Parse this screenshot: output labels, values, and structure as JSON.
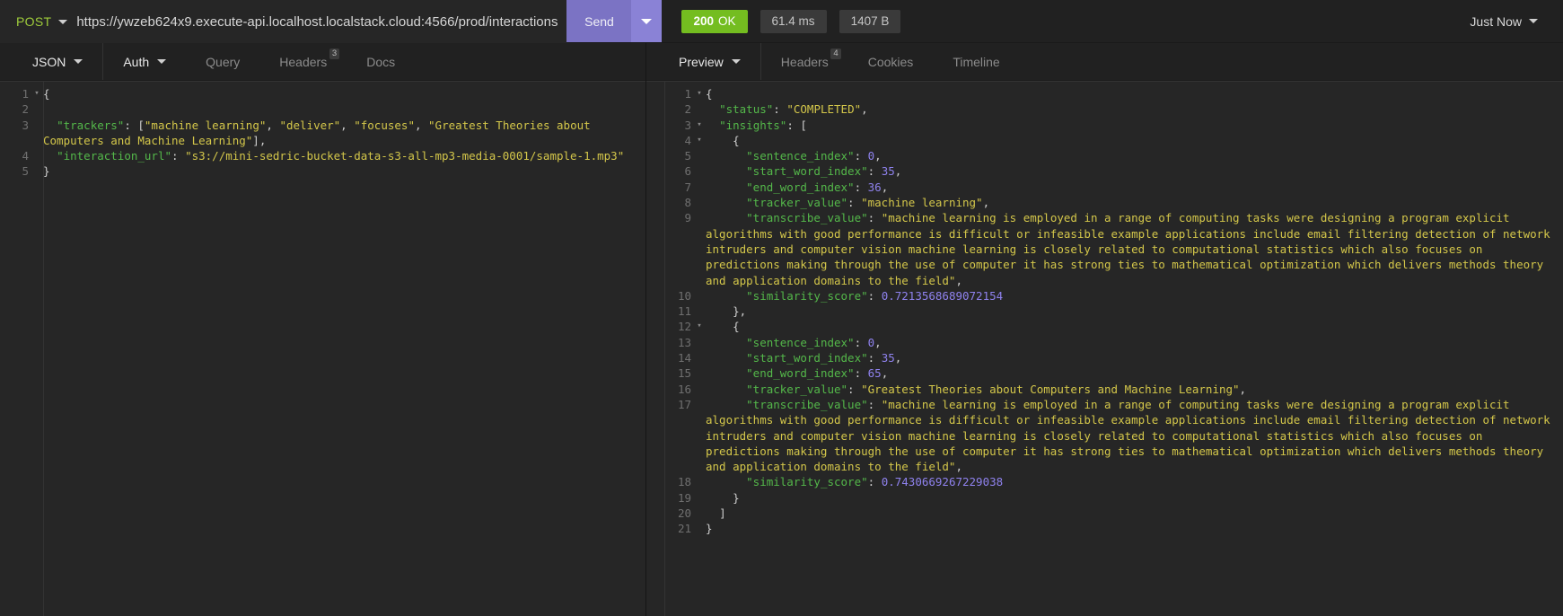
{
  "topbar": {
    "method": "POST",
    "url": "https://ywzeb624x9.execute-api.localhost.localstack.cloud:4566/prod/interactions",
    "send_label": "Send",
    "status_code": "200",
    "status_text": "OK",
    "time": "61.4 ms",
    "size": "1407 B",
    "history_label": "Just Now"
  },
  "request_panel": {
    "tabs": [
      {
        "label": "JSON",
        "caret": true,
        "badge": "",
        "strong": true
      },
      {
        "label": "Auth",
        "caret": true,
        "badge": "",
        "strong": true
      },
      {
        "label": "Query",
        "caret": false,
        "badge": "",
        "strong": false
      },
      {
        "label": "Headers",
        "caret": false,
        "badge": "3",
        "strong": false
      },
      {
        "label": "Docs",
        "caret": false,
        "badge": "",
        "strong": false
      }
    ],
    "body_lines": [
      {
        "num": "1",
        "fold": "▾",
        "tokens": [
          {
            "t": "{",
            "c": "p"
          }
        ]
      },
      {
        "num": "2",
        "fold": "",
        "tokens": []
      },
      {
        "num": "3",
        "fold": "",
        "tokens": [
          {
            "t": "  \"trackers\"",
            "c": "k"
          },
          {
            "t": ": [",
            "c": "p"
          },
          {
            "t": "\"machine learning\"",
            "c": "s"
          },
          {
            "t": ", ",
            "c": "p"
          },
          {
            "t": "\"deliver\"",
            "c": "s"
          },
          {
            "t": ", ",
            "c": "p"
          },
          {
            "t": "\"focuses\"",
            "c": "s"
          },
          {
            "t": ", ",
            "c": "p"
          },
          {
            "t": "\"Greatest Theories about Computers and Machine Learning\"",
            "c": "s"
          },
          {
            "t": "],",
            "c": "p"
          }
        ]
      },
      {
        "num": "4",
        "fold": "",
        "tokens": [
          {
            "t": "  \"interaction_url\"",
            "c": "k"
          },
          {
            "t": ": ",
            "c": "p"
          },
          {
            "t": "\"s3://mini-sedric-bucket-data-s3-all-mp3-media-0001/sample-1.mp3\"",
            "c": "s"
          }
        ]
      },
      {
        "num": "5",
        "fold": "",
        "tokens": [
          {
            "t": "}",
            "c": "p"
          }
        ]
      }
    ]
  },
  "response_panel": {
    "tabs": [
      {
        "label": "Preview",
        "caret": true,
        "badge": "",
        "strong": true
      },
      {
        "label": "Headers",
        "caret": false,
        "badge": "4",
        "strong": false
      },
      {
        "label": "Cookies",
        "caret": false,
        "badge": "",
        "strong": false
      },
      {
        "label": "Timeline",
        "caret": false,
        "badge": "",
        "strong": false
      }
    ],
    "body_lines": [
      {
        "num": "1",
        "fold": "▾",
        "tokens": [
          {
            "t": "{",
            "c": "p"
          }
        ]
      },
      {
        "num": "2",
        "fold": "",
        "tokens": [
          {
            "t": "  \"status\"",
            "c": "k"
          },
          {
            "t": ": ",
            "c": "p"
          },
          {
            "t": "\"COMPLETED\"",
            "c": "s"
          },
          {
            "t": ",",
            "c": "p"
          }
        ]
      },
      {
        "num": "3",
        "fold": "▾",
        "tokens": [
          {
            "t": "  \"insights\"",
            "c": "k"
          },
          {
            "t": ": [",
            "c": "p"
          }
        ]
      },
      {
        "num": "4",
        "fold": "▾",
        "tokens": [
          {
            "t": "    {",
            "c": "p"
          }
        ]
      },
      {
        "num": "5",
        "fold": "",
        "tokens": [
          {
            "t": "      \"sentence_index\"",
            "c": "k"
          },
          {
            "t": ": ",
            "c": "p"
          },
          {
            "t": "0",
            "c": "n"
          },
          {
            "t": ",",
            "c": "p"
          }
        ]
      },
      {
        "num": "6",
        "fold": "",
        "tokens": [
          {
            "t": "      \"start_word_index\"",
            "c": "k"
          },
          {
            "t": ": ",
            "c": "p"
          },
          {
            "t": "35",
            "c": "n"
          },
          {
            "t": ",",
            "c": "p"
          }
        ]
      },
      {
        "num": "7",
        "fold": "",
        "tokens": [
          {
            "t": "      \"end_word_index\"",
            "c": "k"
          },
          {
            "t": ": ",
            "c": "p"
          },
          {
            "t": "36",
            "c": "n"
          },
          {
            "t": ",",
            "c": "p"
          }
        ]
      },
      {
        "num": "8",
        "fold": "",
        "tokens": [
          {
            "t": "      \"tracker_value\"",
            "c": "k"
          },
          {
            "t": ": ",
            "c": "p"
          },
          {
            "t": "\"machine learning\"",
            "c": "s"
          },
          {
            "t": ",",
            "c": "p"
          }
        ]
      },
      {
        "num": "9",
        "fold": "",
        "tokens": [
          {
            "t": "      \"transcribe_value\"",
            "c": "k"
          },
          {
            "t": ": ",
            "c": "p"
          },
          {
            "t": "\"machine learning is employed in a range of computing tasks were designing a program explicit algorithms with good performance is difficult or infeasible example applications include email filtering detection of network intruders and computer vision machine learning is closely related to computational statistics which also focuses on predictions making through the use of computer it has strong ties to mathematical optimization which delivers methods theory and application domains to the field\"",
            "c": "s"
          },
          {
            "t": ",",
            "c": "p"
          }
        ]
      },
      {
        "num": "10",
        "fold": "",
        "tokens": [
          {
            "t": "      \"similarity_score\"",
            "c": "k"
          },
          {
            "t": ": ",
            "c": "p"
          },
          {
            "t": "0.7213568689072154",
            "c": "n"
          }
        ]
      },
      {
        "num": "11",
        "fold": "",
        "tokens": [
          {
            "t": "    },",
            "c": "p"
          }
        ]
      },
      {
        "num": "12",
        "fold": "▾",
        "tokens": [
          {
            "t": "    {",
            "c": "p"
          }
        ]
      },
      {
        "num": "13",
        "fold": "",
        "tokens": [
          {
            "t": "      \"sentence_index\"",
            "c": "k"
          },
          {
            "t": ": ",
            "c": "p"
          },
          {
            "t": "0",
            "c": "n"
          },
          {
            "t": ",",
            "c": "p"
          }
        ]
      },
      {
        "num": "14",
        "fold": "",
        "tokens": [
          {
            "t": "      \"start_word_index\"",
            "c": "k"
          },
          {
            "t": ": ",
            "c": "p"
          },
          {
            "t": "35",
            "c": "n"
          },
          {
            "t": ",",
            "c": "p"
          }
        ]
      },
      {
        "num": "15",
        "fold": "",
        "tokens": [
          {
            "t": "      \"end_word_index\"",
            "c": "k"
          },
          {
            "t": ": ",
            "c": "p"
          },
          {
            "t": "65",
            "c": "n"
          },
          {
            "t": ",",
            "c": "p"
          }
        ]
      },
      {
        "num": "16",
        "fold": "",
        "tokens": [
          {
            "t": "      \"tracker_value\"",
            "c": "k"
          },
          {
            "t": ": ",
            "c": "p"
          },
          {
            "t": "\"Greatest Theories about Computers and Machine Learning\"",
            "c": "s"
          },
          {
            "t": ",",
            "c": "p"
          }
        ]
      },
      {
        "num": "17",
        "fold": "",
        "tokens": [
          {
            "t": "      \"transcribe_value\"",
            "c": "k"
          },
          {
            "t": ": ",
            "c": "p"
          },
          {
            "t": "\"machine learning is employed in a range of computing tasks were designing a program explicit algorithms with good performance is difficult or infeasible example applications include email filtering detection of network intruders and computer vision machine learning is closely related to computational statistics which also focuses on predictions making through the use of computer it has strong ties to mathematical optimization which delivers methods theory and application domains to the field\"",
            "c": "s"
          },
          {
            "t": ",",
            "c": "p"
          }
        ]
      },
      {
        "num": "18",
        "fold": "",
        "tokens": [
          {
            "t": "      \"similarity_score\"",
            "c": "k"
          },
          {
            "t": ": ",
            "c": "p"
          },
          {
            "t": "0.7430669267229038",
            "c": "n"
          }
        ]
      },
      {
        "num": "19",
        "fold": "",
        "tokens": [
          {
            "t": "    }",
            "c": "p"
          }
        ]
      },
      {
        "num": "20",
        "fold": "",
        "tokens": [
          {
            "t": "  ]",
            "c": "p"
          }
        ]
      },
      {
        "num": "21",
        "fold": "",
        "tokens": [
          {
            "t": "}",
            "c": "p"
          }
        ]
      }
    ]
  },
  "colors": {
    "accent_send": "#7b73c4",
    "status_ok": "#74bd20",
    "json_key": "#54b84a",
    "json_string": "#d4c74a",
    "json_number": "#8f82ee",
    "method_post": "#9fcc3b"
  }
}
